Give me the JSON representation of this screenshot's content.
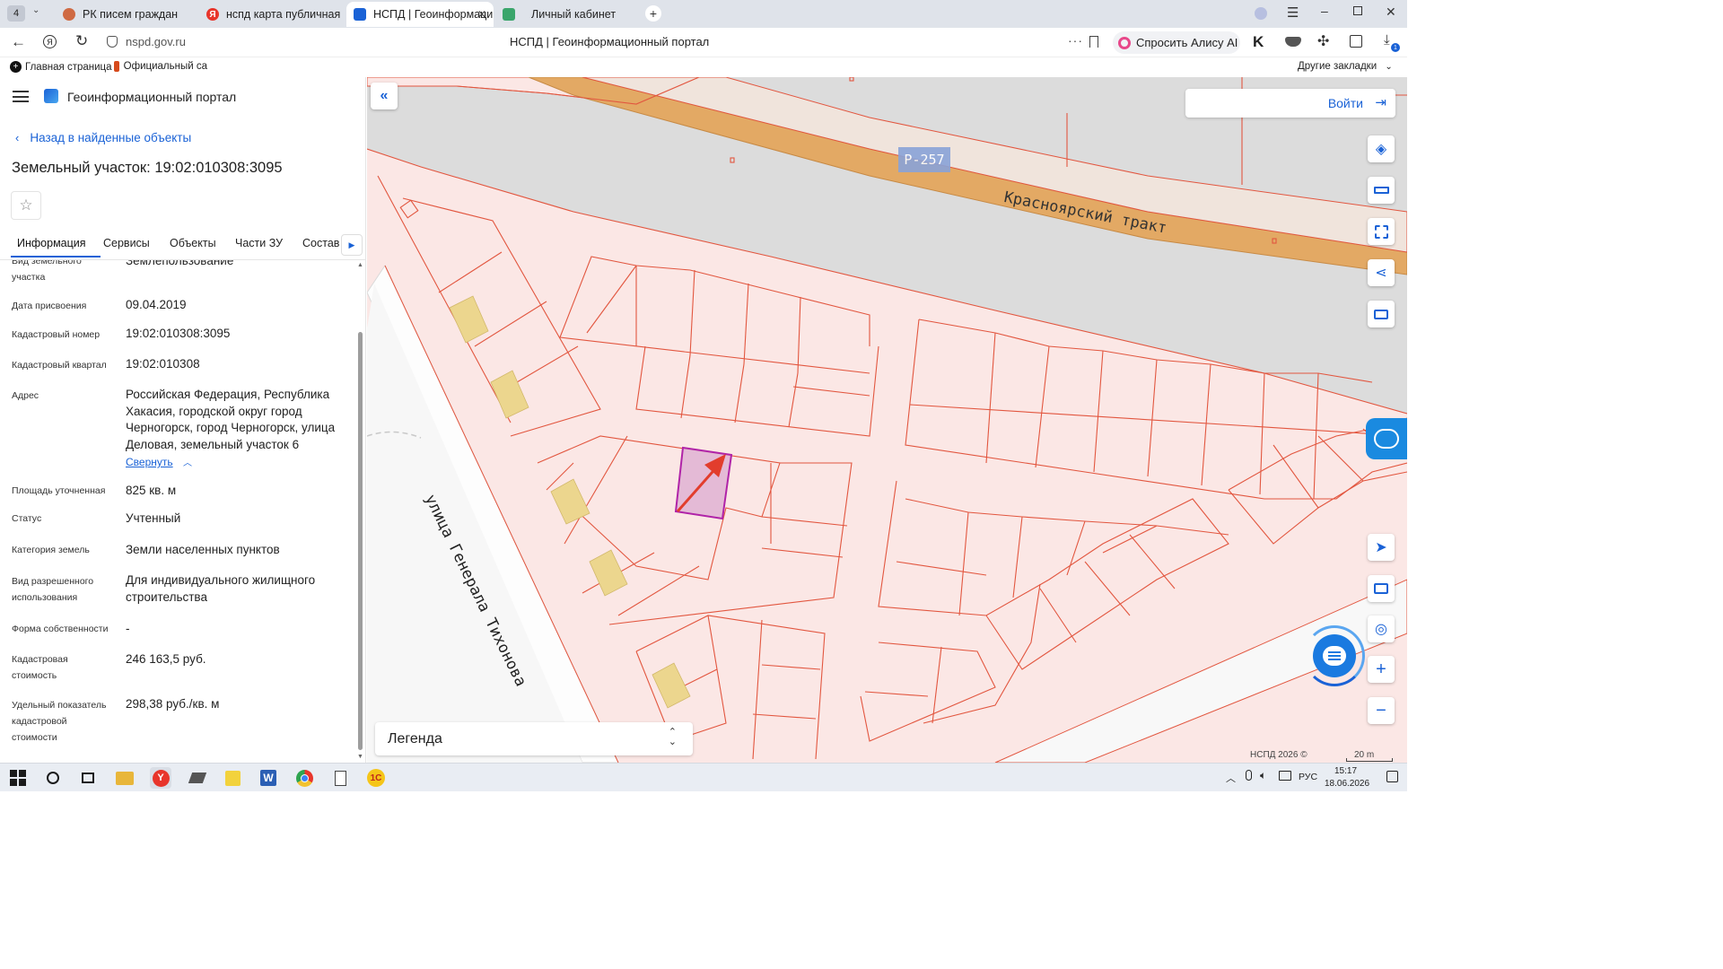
{
  "browser": {
    "tab_count": "4",
    "tabs": [
      {
        "title": "РК писем граждан",
        "icon": "circle-app-icon"
      },
      {
        "title": "нспд карта публичная кад",
        "icon": "yandex-icon"
      },
      {
        "title": "НСПД | Геоинформаци",
        "icon": "nspd-icon"
      },
      {
        "title": "Личный кабинет",
        "icon": "emblem-icon"
      }
    ],
    "url": "nspd.gov.ru",
    "page_title": "НСПД | Геоинформационный портал",
    "alice_label": "Спросить Алису AI",
    "downloads_badge": "1",
    "bookmarks": [
      {
        "label": "Главная страница"
      },
      {
        "label": "Официальный са"
      }
    ],
    "other_bookmarks": "Другие закладки"
  },
  "panel": {
    "portal_title": "Геоинформационный портал",
    "back_link": "Назад в найденные объекты",
    "object_title": "Земельный участок: 19:02:010308:3095",
    "tabs": [
      "Информация",
      "Сервисы",
      "Объекты",
      "Части ЗУ",
      "Состав"
    ],
    "rows": [
      {
        "label": "Вид земельного участка",
        "value": "Землепользование"
      },
      {
        "label": "Дата присвоения",
        "value": "09.04.2019"
      },
      {
        "label": "Кадастровый номер",
        "value": "19:02:010308:3095"
      },
      {
        "label": "Кадастровый квартал",
        "value": "19:02:010308"
      },
      {
        "label": "Адрес",
        "value": "Российская Федерация, Республика Хакасия, городской округ город Черногорск, город Черногорск, улица Деловая, земельный участок 6"
      },
      {
        "label": "Площадь уточненная",
        "value": "825 кв. м"
      },
      {
        "label": "Статус",
        "value": "Учтенный"
      },
      {
        "label": "Категория земель",
        "value": "Земли населенных пунктов"
      },
      {
        "label": "Вид разрешенного использования",
        "value": "Для индивидуального жилищного строительства"
      },
      {
        "label": "Форма собственности",
        "value": "-"
      },
      {
        "label": "Кадастровая стоимость",
        "value": "246 163,5 руб."
      },
      {
        "label": "Удельный показатель кадастровой стоимости",
        "value": "298,38 руб./кв. м"
      }
    ],
    "collapse_link": "Свернуть"
  },
  "map": {
    "login_label": "Войти",
    "road_badge": "Р-257",
    "road_name": "Красноярский тракт",
    "street_name": "улица Генерала Тихонова",
    "legend_label": "Легенда",
    "copyright": "НСПД 2026 ©",
    "scale_label": "20 m"
  },
  "taskbar": {
    "language": "РУС",
    "time": "15:17",
    "date": "18.06.2026"
  },
  "colors": {
    "accent": "#1a62d6",
    "road": "#e3a964",
    "parcel_line": "#e2563f",
    "selected_parcel": "#b023a8",
    "building": "#ecd68e"
  }
}
